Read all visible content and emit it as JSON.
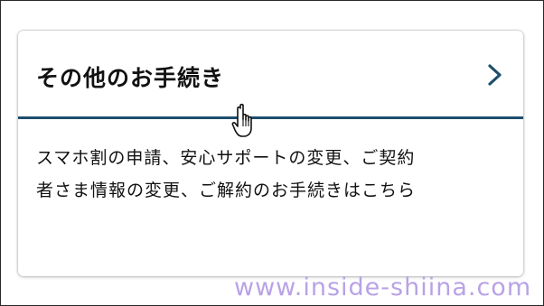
{
  "card": {
    "title": "その他のお手続き",
    "description_line1": "スマホ割の申請、安心サポートの変更、ご契約",
    "description_line2": "者さま情報の変更、ご解約のお手続きはこちら"
  },
  "icons": {
    "chevron": "chevron-right-icon",
    "cursor": "hand-pointer-cursor-icon"
  },
  "watermark": {
    "text": "www.inside-shiina.com"
  },
  "colors": {
    "divider": "#1d4e6d",
    "chevron": "#1d4e6d",
    "watermark": "#b9a2e6"
  }
}
